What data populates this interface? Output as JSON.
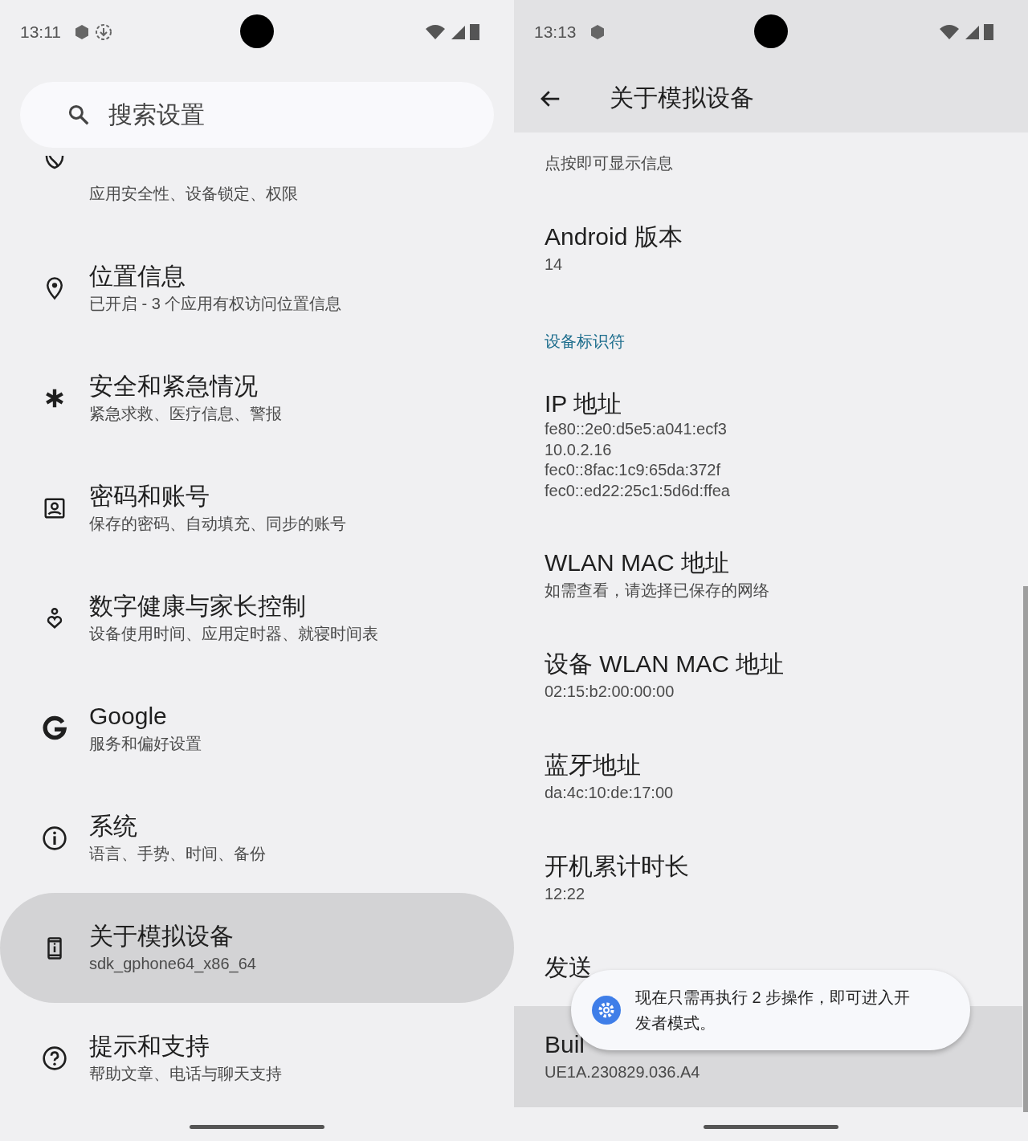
{
  "left_screen": {
    "status_bar": {
      "time": "13:11",
      "notification_icons": [
        {
          "kind": "hexagon"
        },
        {
          "kind": "download"
        }
      ]
    },
    "search": {
      "placeholder": "搜索设置"
    },
    "items": [
      {
        "kind": "shield",
        "subtitle": "应用安全性、设备锁定、权限",
        "selected": false
      },
      {
        "kind": "pin",
        "title": "位置信息",
        "subtitle": "已开启 - 3 个应用有权访问位置信息",
        "selected": false
      },
      {
        "kind": "asterisk",
        "title": "安全和紧急情况",
        "subtitle": "紧急求救、医疗信息、警报",
        "selected": false
      },
      {
        "kind": "account",
        "title": "密码和账号",
        "subtitle": "保存的密码、自动填充、同步的账号",
        "selected": false
      },
      {
        "kind": "wellbeing",
        "title": "数字健康与家长控制",
        "subtitle": "设备使用时间、应用定时器、就寝时间表",
        "selected": false
      },
      {
        "kind": "g",
        "title": "Google",
        "subtitle": "服务和偏好设置",
        "selected": false
      },
      {
        "kind": "info",
        "title": "系统",
        "subtitle": "语言、手势、时间、备份",
        "selected": false
      },
      {
        "kind": "phone",
        "title": "关于模拟设备",
        "subtitle": "sdk_gphone64_x86_64",
        "selected": true
      },
      {
        "kind": "help",
        "title": "提示和支持",
        "subtitle": "帮助文章、电话与聊天支持",
        "selected": false
      }
    ]
  },
  "right_screen": {
    "status_bar": {
      "time": "13:13",
      "notification_icons": [
        {
          "kind": "hexagon"
        }
      ]
    },
    "header": {
      "title": "关于模拟设备"
    },
    "items": [
      {
        "kind": "setting",
        "lines": [
          "点按即可显示信息"
        ],
        "selected": false
      },
      {
        "kind": "setting",
        "title": "Android 版本",
        "lines": [
          "14"
        ],
        "selected": false
      },
      {
        "kind": "section",
        "title": "设备标识符"
      },
      {
        "kind": "setting",
        "title": "IP 地址",
        "lines": [
          "fe80::2e0:d5e5:a041:ecf3",
          "10.0.2.16",
          "fec0::8fac:1c9:65da:372f",
          "fec0::ed22:25c1:5d6d:ffea"
        ],
        "selected": false
      },
      {
        "kind": "setting",
        "title": "WLAN MAC 地址",
        "lines": [
          "如需查看，请选择已保存的网络"
        ],
        "selected": false
      },
      {
        "kind": "setting",
        "title": "设备 WLAN MAC 地址",
        "lines": [
          "02:15:b2:00:00:00"
        ],
        "selected": false
      },
      {
        "kind": "setting",
        "title": "蓝牙地址",
        "lines": [
          "da:4c:10:de:17:00"
        ],
        "selected": false
      },
      {
        "kind": "setting",
        "title": "开机累计时长",
        "lines": [
          "12:22"
        ],
        "selected": false
      },
      {
        "kind": "setting",
        "title": "发送",
        "selected": false
      },
      {
        "kind": "setting",
        "title": "Buil",
        "lines": [
          "UE1A.230829.036.A4"
        ],
        "selected": true
      }
    ],
    "toast": {
      "text": "现在只需再执行 2 步操作，即可进入开发者模式。"
    }
  }
}
